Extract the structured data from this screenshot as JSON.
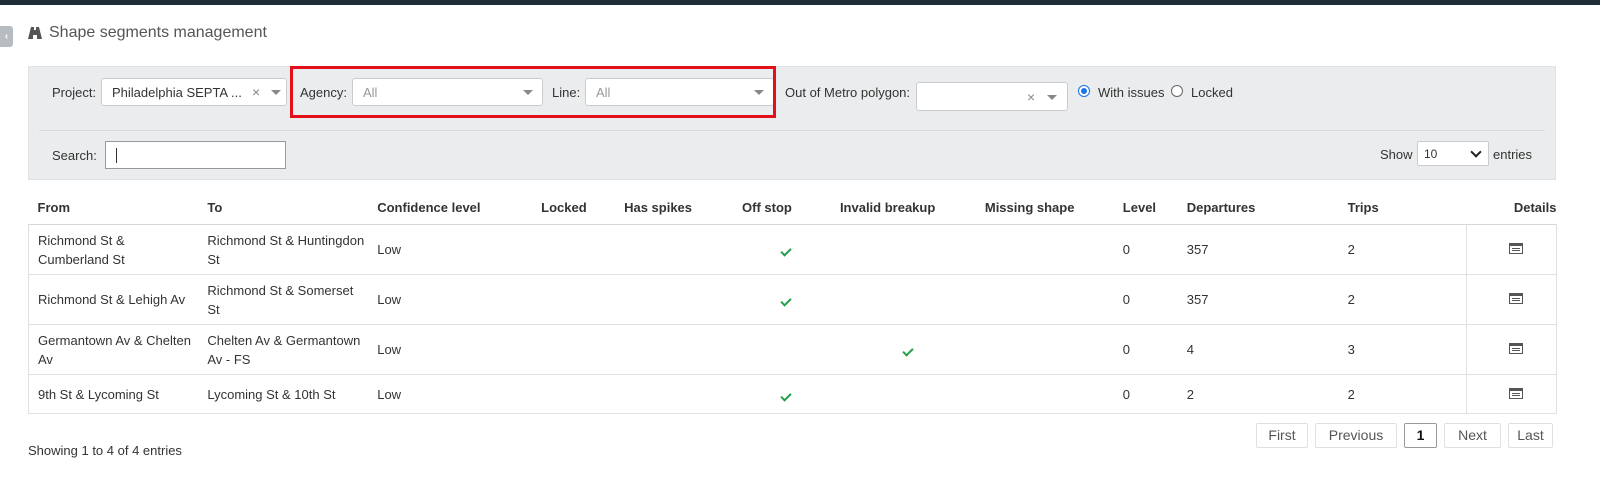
{
  "page": {
    "title": "Shape segments management"
  },
  "filters": {
    "project_label": "Project:",
    "project_value": "Philadelphia SEPTA ...",
    "agency_label": "Agency:",
    "agency_value": "All",
    "line_label": "Line:",
    "line_value": "All",
    "metro_label": "Out of Metro polygon:",
    "metro_value": "",
    "radio_with_issues": "With issues",
    "radio_locked": "Locked",
    "search_label": "Search:",
    "search_value": "",
    "show_label": "Show",
    "show_value": "10",
    "entries_label": "entries"
  },
  "table": {
    "columns": [
      "From",
      "To",
      "Confidence level",
      "Locked",
      "Has spikes",
      "Off stop",
      "Invalid breakup",
      "Missing shape",
      "Level",
      "Departures",
      "Trips",
      "Details"
    ],
    "rows": [
      {
        "from": "Richmond St & Cumberland St",
        "to": "Richmond St & Huntingdon St",
        "confidence": "Low",
        "locked": false,
        "spikes": false,
        "off_stop": true,
        "invalid_breakup": false,
        "missing_shape": false,
        "level": "0",
        "departures": "357",
        "trips": "2"
      },
      {
        "from": "Richmond St & Lehigh Av",
        "to": "Richmond St & Somerset St",
        "confidence": "Low",
        "locked": false,
        "spikes": false,
        "off_stop": true,
        "invalid_breakup": false,
        "missing_shape": false,
        "level": "0",
        "departures": "357",
        "trips": "2"
      },
      {
        "from": "Germantown Av & Chelten Av",
        "to": "Chelten Av & Germantown Av - FS",
        "confidence": "Low",
        "locked": false,
        "spikes": false,
        "off_stop": false,
        "invalid_breakup": true,
        "missing_shape": false,
        "level": "0",
        "departures": "4",
        "trips": "3"
      },
      {
        "from": "9th St & Lycoming St",
        "to": "Lycoming St & 10th St",
        "confidence": "Low",
        "locked": false,
        "spikes": false,
        "off_stop": true,
        "invalid_breakup": false,
        "missing_shape": false,
        "level": "0",
        "departures": "2",
        "trips": "2"
      }
    ]
  },
  "footer": {
    "info": "Showing 1 to 4 of 4 entries",
    "first": "First",
    "previous": "Previous",
    "page": "1",
    "next": "Next",
    "last": "Last"
  },
  "icons": {
    "title_icon": "road-icon",
    "detail_icon": "table-detail-icon",
    "check_icon": "check-icon"
  },
  "colors": {
    "check": "#22a14a",
    "highlight": "#e3101a",
    "radio": "#1a73e8"
  }
}
